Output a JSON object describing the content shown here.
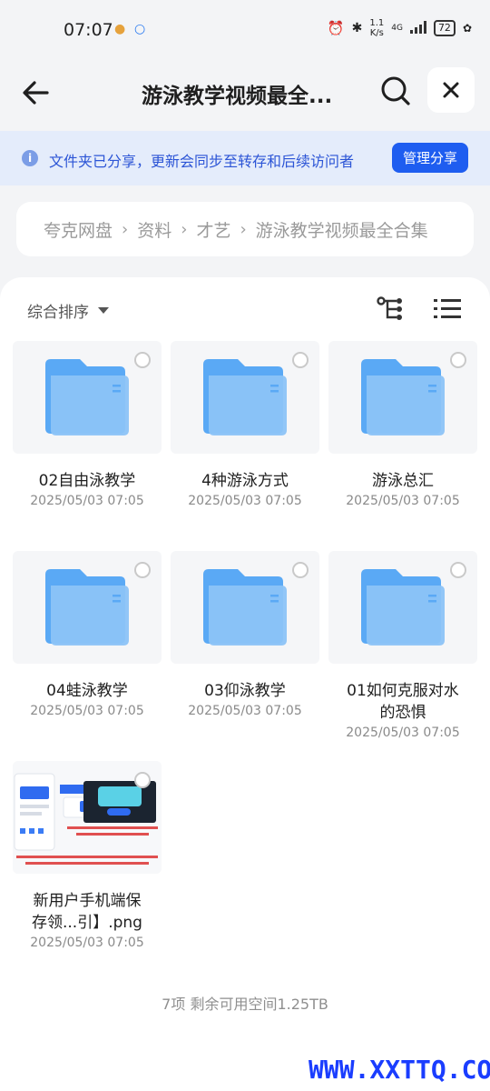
{
  "status_bar": {
    "time": "07:07",
    "net_speed_top": "1.1",
    "net_speed_unit": "K/s",
    "network": "4G",
    "battery": "72"
  },
  "header": {
    "title": "游泳教学视频最全..."
  },
  "notice": {
    "text": "文件夹已分享，更新会同步至转存和后续访问者",
    "manage_label": "管理分享"
  },
  "breadcrumb": [
    "夸克网盘",
    "资料",
    "才艺",
    "游泳教学视频最全合集"
  ],
  "sort": {
    "label": "综合排序"
  },
  "items": [
    {
      "name": "02自由泳教学",
      "date": "2025/05/03 07:05",
      "type": "folder"
    },
    {
      "name": "4种游泳方式",
      "date": "2025/05/03 07:05",
      "type": "folder"
    },
    {
      "name": "游泳总汇",
      "date": "2025/05/03 07:05",
      "type": "folder"
    },
    {
      "name": "04蛙泳教学",
      "date": "2025/05/03 07:05",
      "type": "folder"
    },
    {
      "name": "03仰泳教学",
      "date": "2025/05/03 07:05",
      "type": "folder"
    },
    {
      "name": "01如何克服对水的恐惧",
      "name_line1": "01如何克服对水",
      "name_line2": "的恐惧",
      "date": "2025/05/03 07:05",
      "type": "folder"
    },
    {
      "name": "新用户手机端保存领...引】.png",
      "name_line1": "新用户手机端保",
      "name_line2": "存领...引】.png",
      "date": "2025/05/03 07:05",
      "type": "image"
    }
  ],
  "footer": {
    "text": "7项 剩余可用空间1.25TB"
  },
  "watermark": "WWW.XXTTQ.COM",
  "colors": {
    "accent": "#1e5df0",
    "folder": "#5aa9f5",
    "notice_bg": "#e4ecfb"
  }
}
